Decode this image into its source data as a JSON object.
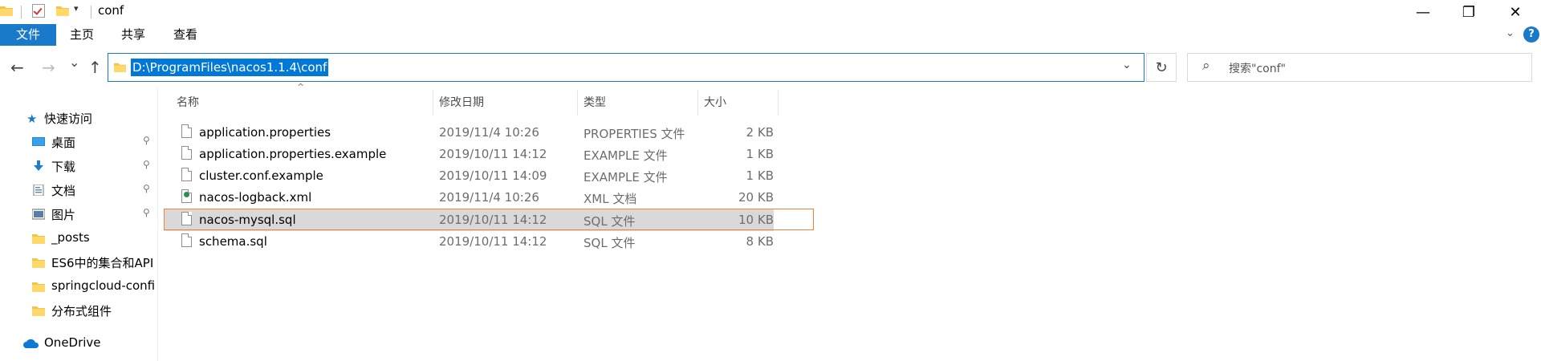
{
  "window": {
    "title": "conf",
    "controls": {
      "minimize": "—",
      "maximize": "❐",
      "close": "✕"
    }
  },
  "ribbon": {
    "tabs": [
      {
        "label": "文件",
        "active": true
      },
      {
        "label": "主页"
      },
      {
        "label": "共享"
      },
      {
        "label": "查看"
      }
    ],
    "help_label": "?"
  },
  "navigation": {
    "back_icon": "←",
    "forward_icon": "→",
    "recent_icon": "⌄",
    "up_icon": "↑",
    "address": "D:\\ProgramFiles\\nacos1.1.4\\conf",
    "address_dropdown_icon": "⌄",
    "refresh_icon": "↻",
    "search_placeholder": "搜索\"conf\"",
    "search_icon": "⌕"
  },
  "sidebar": {
    "quick_access": "快速访问",
    "items": [
      {
        "label": "桌面",
        "icon": "desktop-icon",
        "pinned": true
      },
      {
        "label": "下载",
        "icon": "download-icon",
        "pinned": true
      },
      {
        "label": "文档",
        "icon": "documents-icon",
        "pinned": true
      },
      {
        "label": "图片",
        "icon": "pictures-icon",
        "pinned": true
      },
      {
        "label": "_posts",
        "icon": "folder-icon"
      },
      {
        "label": "ES6中的集合和API",
        "icon": "folder-icon"
      },
      {
        "label": "springcloud-confi",
        "icon": "folder-icon"
      },
      {
        "label": "分布式组件",
        "icon": "folder-icon"
      }
    ],
    "onedrive": "OneDrive",
    "pin_glyph": "📌"
  },
  "columns": {
    "name": "名称",
    "date": "修改日期",
    "type": "类型",
    "size": "大小"
  },
  "files": [
    {
      "name": "application.properties",
      "date": "2019/11/4 10:26",
      "type": "PROPERTIES 文件",
      "size": "2 KB"
    },
    {
      "name": "application.properties.example",
      "date": "2019/10/11 14:12",
      "type": "EXAMPLE 文件",
      "size": "1 KB"
    },
    {
      "name": "cluster.conf.example",
      "date": "2019/10/11 14:09",
      "type": "EXAMPLE 文件",
      "size": "1 KB"
    },
    {
      "name": "nacos-logback.xml",
      "date": "2019/11/4 10:26",
      "type": "XML 文档",
      "size": "20 KB"
    },
    {
      "name": "nacos-mysql.sql",
      "date": "2019/10/11 14:12",
      "type": "SQL 文件",
      "size": "10 KB",
      "selected": true
    },
    {
      "name": "schema.sql",
      "date": "2019/10/11 14:12",
      "type": "SQL 文件",
      "size": "8 KB"
    }
  ],
  "colors": {
    "accent": "#1979ca",
    "selection_border": "#f0823c",
    "folder": "#f4c542"
  }
}
